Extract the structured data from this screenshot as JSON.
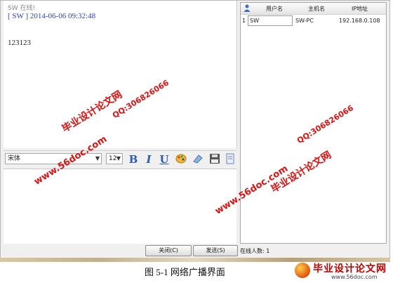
{
  "chat": {
    "online_note": "SW 在线!",
    "header": "[ SW ] 2014-06-06 09:32:48",
    "body": "123123"
  },
  "toolbar": {
    "font_value": "宋体",
    "size_value": "12",
    "bold_label": "B",
    "italic_label": "I",
    "underline_label": "U"
  },
  "users_table": {
    "headers": [
      "用户名",
      "主机名",
      "IP地址"
    ],
    "rows": [
      {
        "index": "1",
        "user": "SW",
        "host": "SW-PC",
        "ip": "192.168.0.108"
      }
    ]
  },
  "buttons": {
    "close": "关闭(C)",
    "send": "发送(S)"
  },
  "status": {
    "online_count": "在线人数: 1"
  },
  "watermarks": {
    "brand": "毕业设计论文网",
    "qq": "QQ:306826066",
    "url": "www.56doc.com"
  },
  "caption": "图 5-1  网络广播界面",
  "logo": {
    "text": "毕业设计论文网",
    "url": "www.56doc.com"
  },
  "colors": {
    "header_blue": "#2b3fd1",
    "watermark_red": "#e01010",
    "bold_blue": "#2d5bb3"
  }
}
